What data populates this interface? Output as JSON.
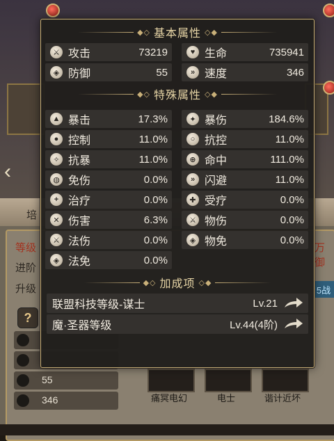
{
  "background": {
    "side_tab_label": "培",
    "panel_labels": {
      "level": "等级",
      "advance": "进阶",
      "upgrade": "升级"
    },
    "help_symbol": "?",
    "rows": [
      {
        "icon": "sword-icon",
        "value": ""
      },
      {
        "icon": "shield-icon",
        "value": ""
      },
      {
        "icon": "shield-icon",
        "value": "55"
      },
      {
        "icon": "speed-icon",
        "value": "346"
      }
    ],
    "cards": [
      "痛冥电幻",
      "电士",
      "谐计近坏"
    ],
    "right_badge": "5战",
    "right_label": "万御"
  },
  "basic": {
    "title": "基本属性",
    "stats": [
      {
        "icon": "attack-icon",
        "name": "攻击",
        "value": "73219"
      },
      {
        "icon": "heart-icon",
        "name": "生命",
        "value": "735941"
      },
      {
        "icon": "defense-icon",
        "name": "防御",
        "value": "55"
      },
      {
        "icon": "speed-icon",
        "name": "速度",
        "value": "346"
      }
    ]
  },
  "special": {
    "title": "特殊属性",
    "stats": [
      {
        "icon": "crit-icon",
        "name": "暴击",
        "value": "17.3%"
      },
      {
        "icon": "crit-damage-icon",
        "name": "暴伤",
        "value": "184.6%"
      },
      {
        "icon": "control-icon",
        "name": "控制",
        "value": "11.0%"
      },
      {
        "icon": "resist-control-icon",
        "name": "抗控",
        "value": "11.0%"
      },
      {
        "icon": "anti-crit-icon",
        "name": "抗暴",
        "value": "11.0%"
      },
      {
        "icon": "hit-icon",
        "name": "命中",
        "value": "111.0%"
      },
      {
        "icon": "damage-reduction-icon",
        "name": "免伤",
        "value": "0.0%"
      },
      {
        "icon": "dodge-icon",
        "name": "闪避",
        "value": "11.0%"
      },
      {
        "icon": "heal-icon",
        "name": "治疗",
        "value": "0.0%"
      },
      {
        "icon": "heal-received-icon",
        "name": "受疗",
        "value": "0.0%"
      },
      {
        "icon": "damage-icon",
        "name": "伤害",
        "value": "6.3%"
      },
      {
        "icon": "physical-damage-icon",
        "name": "物伤",
        "value": "0.0%"
      },
      {
        "icon": "magic-damage-icon",
        "name": "法伤",
        "value": "0.0%"
      },
      {
        "icon": "physical-immune-icon",
        "name": "物免",
        "value": "0.0%"
      },
      {
        "icon": "magic-immune-icon",
        "name": "法免",
        "value": "0.0%"
      }
    ]
  },
  "bonus": {
    "title": "加成项",
    "items": [
      {
        "name": "联盟科技等级-谋士",
        "level": "Lv.21"
      },
      {
        "name": "魔·圣器等级",
        "level": "Lv.44(4阶)"
      }
    ]
  }
}
